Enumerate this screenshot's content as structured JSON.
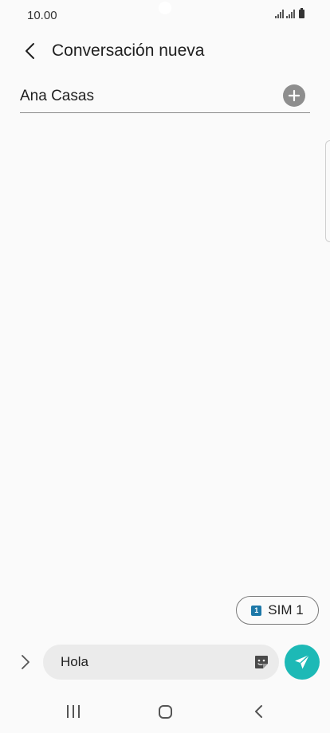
{
  "status_bar": {
    "time": "10.00"
  },
  "header": {
    "title": "Conversación nueva",
    "back_icon": "chevron-left-icon"
  },
  "recipient": {
    "name": "Ana Casas",
    "add_icon": "plus-circle-icon"
  },
  "sim_selector": {
    "badge": "1",
    "label": "SIM 1",
    "badge_color": "#1d78a8"
  },
  "composer": {
    "message_value": "Hola",
    "expand_icon": "chevron-right-icon",
    "sticker_icon": "sticker-icon",
    "send_icon": "send-icon",
    "send_color": "#1db9b6"
  },
  "nav_bar": {
    "recents_icon": "recents-icon",
    "home_icon": "home-icon",
    "back_icon": "back-icon"
  }
}
